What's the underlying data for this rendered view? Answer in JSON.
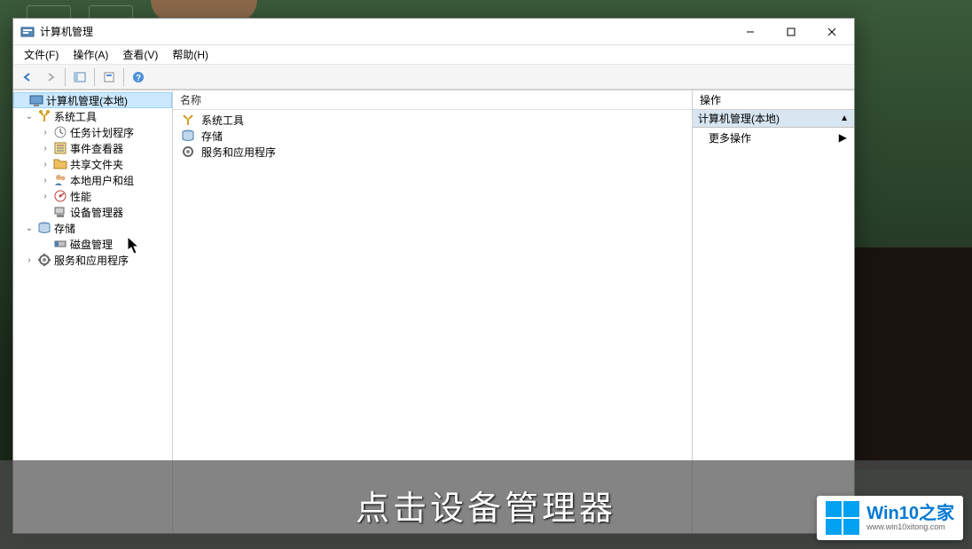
{
  "window": {
    "title": "计算机管理"
  },
  "menu": {
    "file": "文件(F)",
    "action": "操作(A)",
    "view": "查看(V)",
    "help": "帮助(H)"
  },
  "tree": {
    "root": "计算机管理(本地)",
    "system_tools": "系统工具",
    "task_scheduler": "任务计划程序",
    "event_viewer": "事件查看器",
    "shared_folders": "共享文件夹",
    "local_users": "本地用户和组",
    "performance": "性能",
    "device_manager": "设备管理器",
    "storage": "存储",
    "disk_management": "磁盘管理",
    "services_apps": "服务和应用程序"
  },
  "list": {
    "header": "名称",
    "items": {
      "system_tools": "系统工具",
      "storage": "存储",
      "services_apps": "服务和应用程序"
    }
  },
  "actions": {
    "header": "操作",
    "section": "计算机管理(本地)",
    "more": "更多操作"
  },
  "caption": "点击设备管理器",
  "watermark": {
    "main": "Win10之家",
    "sub": "www.win10xitong.com"
  }
}
